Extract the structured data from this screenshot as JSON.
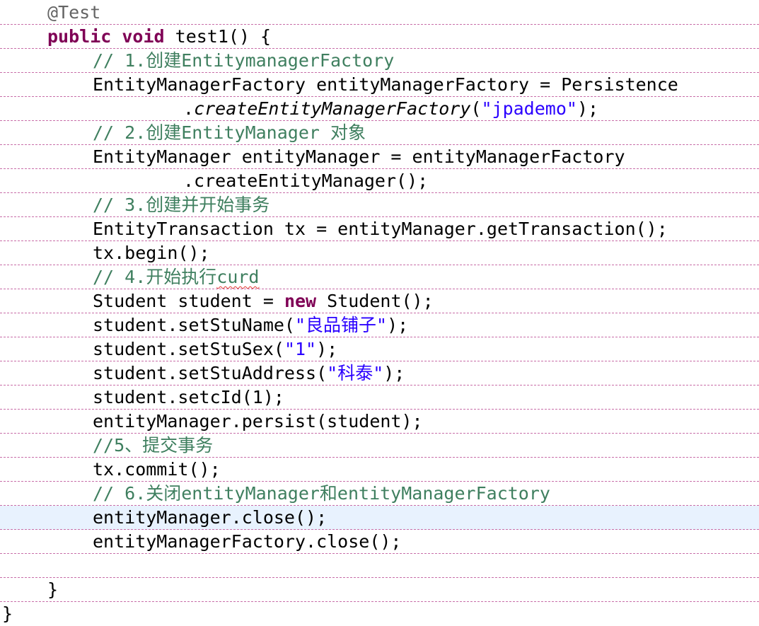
{
  "colors": {
    "keyword": "#7f0055",
    "annotation": "#646464",
    "comment": "#3f7f5f",
    "string": "#2a00ff",
    "text": "#000000",
    "current_line_highlight": "#e8f2fe",
    "line_separator": "#c86ea8"
  },
  "code_lines": [
    {
      "indent": 1,
      "tokens": [
        {
          "t": "@Test",
          "c": "ann"
        }
      ]
    },
    {
      "indent": 1,
      "tokens": [
        {
          "t": "public",
          "c": "kw"
        },
        {
          "t": " ",
          "c": "pl"
        },
        {
          "t": "void",
          "c": "kw"
        },
        {
          "t": " test1() {",
          "c": "pl"
        }
      ]
    },
    {
      "indent": 2,
      "tokens": [
        {
          "t": "// 1.创建EntitymanagerFactory",
          "c": "cm"
        }
      ]
    },
    {
      "indent": 2,
      "tokens": [
        {
          "t": "EntityManagerFactory entityManagerFactory = Persistence",
          "c": "pl"
        }
      ]
    },
    {
      "indent": 4,
      "tokens": [
        {
          "t": ".",
          "c": "pl"
        },
        {
          "t": "createEntityManagerFactory",
          "c": "it"
        },
        {
          "t": "(",
          "c": "pl"
        },
        {
          "t": "\"jpademo\"",
          "c": "str"
        },
        {
          "t": ");",
          "c": "pl"
        }
      ]
    },
    {
      "indent": 2,
      "tokens": [
        {
          "t": "// 2.创建EntityManager 对象",
          "c": "cm"
        }
      ]
    },
    {
      "indent": 2,
      "tokens": [
        {
          "t": "EntityManager entityManager = entityManagerFactory",
          "c": "pl"
        }
      ]
    },
    {
      "indent": 4,
      "tokens": [
        {
          "t": ".createEntityManager();",
          "c": "pl"
        }
      ]
    },
    {
      "indent": 2,
      "tokens": [
        {
          "t": "// 3.创建并开始事务",
          "c": "cm"
        }
      ]
    },
    {
      "indent": 2,
      "tokens": [
        {
          "t": "EntityTransaction tx = entityManager.getTransaction();",
          "c": "pl"
        }
      ]
    },
    {
      "indent": 2,
      "tokens": [
        {
          "t": "tx.begin();",
          "c": "pl"
        }
      ]
    },
    {
      "indent": 2,
      "tokens": [
        {
          "t": "// 4.开始执行",
          "c": "cm"
        },
        {
          "t": "curd",
          "c": "cm sq"
        }
      ]
    },
    {
      "indent": 2,
      "tokens": [
        {
          "t": "Student student = ",
          "c": "pl"
        },
        {
          "t": "new",
          "c": "kw"
        },
        {
          "t": " Student();",
          "c": "pl"
        }
      ]
    },
    {
      "indent": 2,
      "tokens": [
        {
          "t": "student.setStuName(",
          "c": "pl"
        },
        {
          "t": "\"良品铺子\"",
          "c": "str"
        },
        {
          "t": ");",
          "c": "pl"
        }
      ]
    },
    {
      "indent": 2,
      "tokens": [
        {
          "t": "student.setStuSex(",
          "c": "pl"
        },
        {
          "t": "\"1\"",
          "c": "str"
        },
        {
          "t": ");",
          "c": "pl"
        }
      ]
    },
    {
      "indent": 2,
      "tokens": [
        {
          "t": "student.setStuAddress(",
          "c": "pl"
        },
        {
          "t": "\"科泰\"",
          "c": "str"
        },
        {
          "t": ");",
          "c": "pl"
        }
      ]
    },
    {
      "indent": 2,
      "tokens": [
        {
          "t": "student.setcId(1);",
          "c": "pl"
        }
      ]
    },
    {
      "indent": 2,
      "tokens": [
        {
          "t": "entityManager.persist(student);",
          "c": "pl"
        }
      ]
    },
    {
      "indent": 2,
      "tokens": [
        {
          "t": "//5、提交事务",
          "c": "cm"
        }
      ]
    },
    {
      "indent": 2,
      "tokens": [
        {
          "t": "tx.commit();",
          "c": "pl"
        }
      ]
    },
    {
      "indent": 2,
      "tokens": [
        {
          "t": "// 6.关闭entityManager和entityManagerFactory",
          "c": "cm"
        }
      ]
    },
    {
      "indent": 2,
      "current": true,
      "tokens": [
        {
          "t": "entityManager.close();",
          "c": "pl"
        }
      ]
    },
    {
      "indent": 2,
      "tokens": [
        {
          "t": "entityManagerFactory.close();",
          "c": "pl"
        }
      ]
    },
    {
      "indent": 0,
      "tokens": []
    },
    {
      "indent": 1,
      "tokens": [
        {
          "t": "}",
          "c": "pl"
        }
      ]
    },
    {
      "indent": 0,
      "tokens": [
        {
          "t": "}",
          "c": "pl"
        }
      ]
    }
  ]
}
